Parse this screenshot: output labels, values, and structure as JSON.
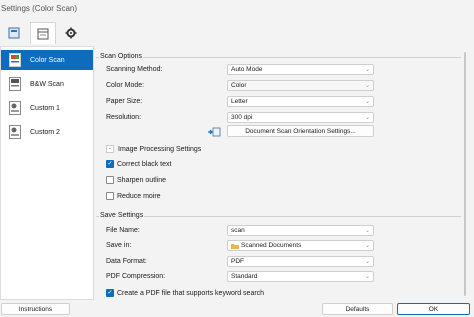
{
  "window": {
    "title": "Settings (Color Scan)"
  },
  "toolbar": {
    "buttons": [
      "scan-settings-icon",
      "page-settings-icon",
      "gear-icon"
    ]
  },
  "profiles": [
    {
      "label": "Color Scan",
      "icon": "color-scan-icon",
      "selected": true
    },
    {
      "label": "B&W Scan",
      "icon": "bw-scan-icon",
      "selected": false
    },
    {
      "label": "Custom 1",
      "icon": "custom-scan-icon",
      "selected": false
    },
    {
      "label": "Custom 2",
      "icon": "custom-scan-icon",
      "selected": false
    }
  ],
  "scan_options": {
    "heading": "Scan Options",
    "scanning_method": {
      "label": "Scanning Method:",
      "value": "Auto Mode"
    },
    "color_mode": {
      "label": "Color Mode:",
      "value": "Color"
    },
    "paper_size": {
      "label": "Paper Size:",
      "value": "Letter"
    },
    "resolution": {
      "label": "Resolution:",
      "value": "300 dpi"
    },
    "orientation_button": "Document Scan Orientation Settings...",
    "image_processing": "Image Processing Settings",
    "checkboxes": [
      {
        "label": "Correct black text",
        "checked": true
      },
      {
        "label": "Sharpen outline",
        "checked": false
      },
      {
        "label": "Reduce moire",
        "checked": false
      }
    ]
  },
  "save_settings": {
    "heading": "Save Settings",
    "file_name": {
      "label": "File Name:",
      "value": "scan"
    },
    "save_in": {
      "label": "Save in:",
      "value": "Scanned Documents"
    },
    "data_format": {
      "label": "Data Format:",
      "value": "PDF"
    },
    "pdf_compression": {
      "label": "PDF Compression:",
      "value": "Standard"
    },
    "keyword_search": {
      "label": "Create a PDF file that supports keyword search",
      "checked": true
    }
  },
  "buttons": {
    "instructions": "Instructions",
    "defaults": "Defaults",
    "ok": "OK"
  },
  "colors": {
    "accent": "#0f6cbd",
    "background": "#f3f3f3"
  }
}
